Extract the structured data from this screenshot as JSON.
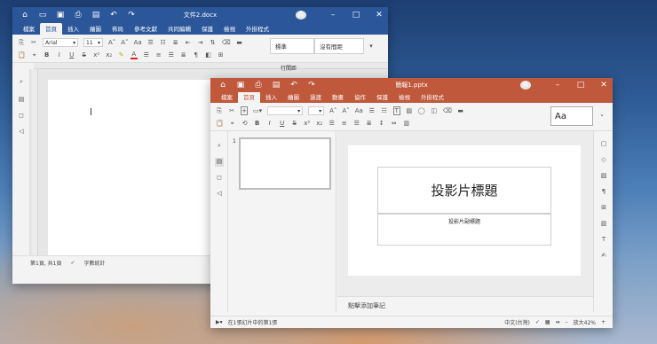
{
  "writer": {
    "title": "文件2.docx",
    "avatar": "A",
    "menu": [
      "檔案",
      "首頁",
      "插入",
      "繪圖",
      "佈局",
      "參考文獻",
      "共同編輯",
      "保護",
      "檢視",
      "外掛程式"
    ],
    "active_menu": 1,
    "font_name": "Arial",
    "font_size": "11",
    "style_normal": "標準",
    "style_nospacing": "沒有間距",
    "paragraph_label": "行間距",
    "status_page": "第1頁, 共1頁",
    "status_wordcount": "字數統計"
  },
  "impress": {
    "title": "簡報1.pptx",
    "avatar": "A",
    "menu": [
      "檔案",
      "首頁",
      "插入",
      "繪圖",
      "過渡",
      "動畫",
      "協作",
      "保護",
      "檢視",
      "外掛程式"
    ],
    "active_menu": 1,
    "layout_preview": "Aa",
    "slide_number": "1",
    "slide_title": "投影片標題",
    "slide_subtitle": "投影片副標題",
    "notes_placeholder": "點擊添加筆記",
    "status_slide": "在1張幻片中的第1張",
    "status_language": "中文(台灣)",
    "zoom": "放大42%"
  }
}
